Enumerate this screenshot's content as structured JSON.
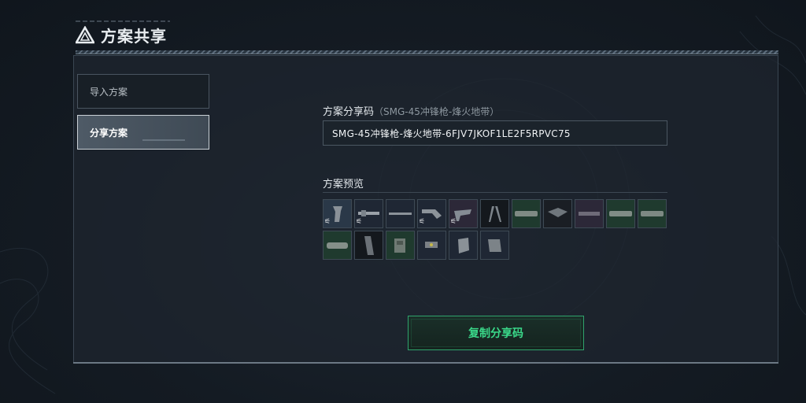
{
  "header": {
    "title": "方案共享",
    "icon": "triangle-logo-icon"
  },
  "sidebar": {
    "items": [
      {
        "label": "导入方案",
        "active": false
      },
      {
        "label": "分享方案",
        "active": true
      }
    ]
  },
  "share": {
    "label": "方案分享码",
    "sublabel": "（SMG-45冲锋枪-烽火地带）",
    "code": "SMG-45冲锋枪-烽火地带-6FJV7JKOF1LE2F5RPVC75"
  },
  "preview": {
    "label": "方案预览",
    "parts": [
      {
        "icon": "grip-icon",
        "bg": "blue",
        "mod": true
      },
      {
        "icon": "barrel-icon",
        "bg": "navy",
        "mod": true
      },
      {
        "icon": "rail-icon",
        "bg": "navy",
        "mod": false
      },
      {
        "icon": "stock-icon",
        "bg": "navy",
        "mod": true
      },
      {
        "icon": "foregrip-icon",
        "bg": "purple",
        "mod": true
      },
      {
        "icon": "bipod-icon",
        "bg": "dark",
        "mod": false
      },
      {
        "icon": "suppressor-icon",
        "bg": "green",
        "mod": false
      },
      {
        "icon": "scope-icon",
        "bg": "charcoal",
        "mod": false
      },
      {
        "icon": "handguard-icon",
        "bg": "purple",
        "mod": false
      },
      {
        "icon": "muzzle-icon",
        "bg": "green",
        "mod": false
      },
      {
        "icon": "barrel-extension-icon",
        "bg": "green",
        "mod": false
      },
      {
        "icon": "silencer-icon",
        "bg": "green",
        "mod": false
      },
      {
        "icon": "magazine-icon",
        "bg": "dark",
        "mod": false
      },
      {
        "icon": "receiver-icon",
        "bg": "green",
        "mod": false
      },
      {
        "icon": "sight-icon",
        "bg": "navy",
        "mod": false
      },
      {
        "icon": "laser-icon",
        "bg": "navy",
        "mod": false
      },
      {
        "icon": "buffer-tube-icon",
        "bg": "navy",
        "mod": false
      }
    ],
    "mod_glyph": "⚟"
  },
  "actions": {
    "copy_label": "复制分享码"
  },
  "colors": {
    "accent": "#3ad98a",
    "panel": "#1e262f"
  }
}
